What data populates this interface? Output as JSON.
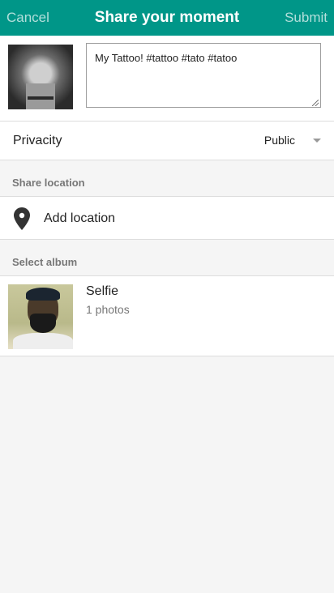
{
  "header": {
    "cancel_label": "Cancel",
    "title": "Share your moment",
    "submit_label": "Submit",
    "background_color": "#009688"
  },
  "post": {
    "caption": "My Tattoo! #tattoo #tato #tatoo"
  },
  "privacy": {
    "label": "Privacity",
    "value": "Public"
  },
  "location": {
    "section_label": "Share location",
    "add_label": "Add location",
    "icon": "location-pin-icon"
  },
  "album": {
    "section_label": "Select album",
    "items": [
      {
        "title": "Selfie",
        "count": "1 photos"
      }
    ]
  }
}
